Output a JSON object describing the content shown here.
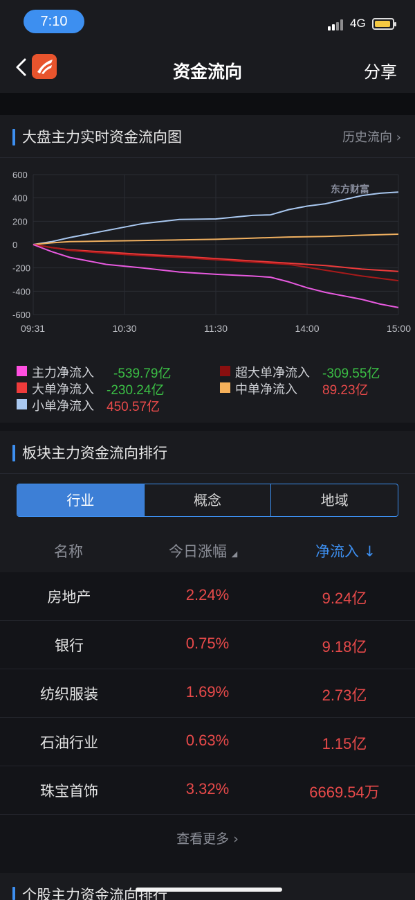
{
  "status": {
    "time": "7:10",
    "network": "4G"
  },
  "nav": {
    "title": "资金流向",
    "share": "分享"
  },
  "chart_section": {
    "title": "大盘主力实时资金流向图",
    "history_link": "历史流向",
    "watermark": "东方财富"
  },
  "chart_data": {
    "type": "line",
    "x_ticks": [
      "09:31",
      "10:30",
      "11:30",
      "14:00",
      "15:00"
    ],
    "y_ticks": [
      "600",
      "400",
      "200",
      "0",
      "-200",
      "-400",
      "-600"
    ],
    "ylim": [
      -600,
      600
    ],
    "grid": true,
    "series": [
      {
        "name": "小单净流入",
        "color": "#a9c8f0",
        "points": [
          [
            0,
            0
          ],
          [
            0.05,
            25
          ],
          [
            0.1,
            60
          ],
          [
            0.2,
            120
          ],
          [
            0.3,
            180
          ],
          [
            0.4,
            215
          ],
          [
            0.5,
            220
          ],
          [
            0.6,
            250
          ],
          [
            0.65,
            255
          ],
          [
            0.7,
            300
          ],
          [
            0.75,
            330
          ],
          [
            0.8,
            350
          ],
          [
            0.85,
            385
          ],
          [
            0.9,
            420
          ],
          [
            0.95,
            440
          ],
          [
            1,
            450.57
          ]
        ]
      },
      {
        "name": "中单净流入",
        "color": "#f0b060",
        "points": [
          [
            0,
            0
          ],
          [
            0.05,
            15
          ],
          [
            0.1,
            25
          ],
          [
            0.2,
            30
          ],
          [
            0.3,
            35
          ],
          [
            0.4,
            40
          ],
          [
            0.5,
            45
          ],
          [
            0.6,
            55
          ],
          [
            0.7,
            65
          ],
          [
            0.8,
            70
          ],
          [
            0.9,
            80
          ],
          [
            1,
            89.23
          ]
        ]
      },
      {
        "name": "大单净流入",
        "color": "#ee3b3b",
        "points": [
          [
            0,
            0
          ],
          [
            0.05,
            -25
          ],
          [
            0.1,
            -45
          ],
          [
            0.2,
            -65
          ],
          [
            0.3,
            -85
          ],
          [
            0.4,
            -100
          ],
          [
            0.5,
            -120
          ],
          [
            0.6,
            -140
          ],
          [
            0.7,
            -160
          ],
          [
            0.8,
            -180
          ],
          [
            0.9,
            -210
          ],
          [
            1,
            -230.24
          ]
        ]
      },
      {
        "name": "超大单净流入",
        "color": "#a81a1a",
        "points": [
          [
            0,
            0
          ],
          [
            0.1,
            -50
          ],
          [
            0.2,
            -75
          ],
          [
            0.3,
            -95
          ],
          [
            0.4,
            -110
          ],
          [
            0.5,
            -130
          ],
          [
            0.6,
            -150
          ],
          [
            0.7,
            -170
          ],
          [
            0.75,
            -195
          ],
          [
            0.8,
            -220
          ],
          [
            0.9,
            -270
          ],
          [
            1,
            -309.55
          ]
        ]
      },
      {
        "name": "主力净流入",
        "color": "#e85ae0",
        "points": [
          [
            0,
            0
          ],
          [
            0.05,
            -60
          ],
          [
            0.1,
            -110
          ],
          [
            0.2,
            -170
          ],
          [
            0.3,
            -200
          ],
          [
            0.4,
            -235
          ],
          [
            0.5,
            -255
          ],
          [
            0.6,
            -270
          ],
          [
            0.65,
            -280
          ],
          [
            0.7,
            -320
          ],
          [
            0.75,
            -370
          ],
          [
            0.8,
            -410
          ],
          [
            0.9,
            -470
          ],
          [
            0.95,
            -510
          ],
          [
            1,
            -539.79
          ]
        ]
      }
    ]
  },
  "legend": [
    {
      "label": "主力净流入",
      "value": "-539.79亿",
      "swatch": "#ff4fe0",
      "value_color": "#3bbf45"
    },
    {
      "label": "超大单净流入",
      "value": "-309.55亿",
      "swatch": "#8a0f0f",
      "value_color": "#3bbf45"
    },
    {
      "label": "大单净流入",
      "value": "-230.24亿",
      "swatch": "#ee3b3b",
      "value_color": "#3bbf45"
    },
    {
      "label": "中单净流入",
      "value": "89.23亿",
      "swatch": "#f5b05a",
      "value_color": "#e84a4a"
    },
    {
      "label": "小单净流入",
      "value": "450.57亿",
      "swatch": "#a9c8f0",
      "value_color": "#e84a4a"
    }
  ],
  "ranking_section": {
    "title": "板块主力资金流向排行",
    "tabs": [
      "行业",
      "概念",
      "地域"
    ],
    "columns": {
      "name": "名称",
      "change": "今日涨幅",
      "flow": "净流入 ↓"
    },
    "rows": [
      {
        "name": "房地产",
        "change": "2.24%",
        "flow": "9.24亿"
      },
      {
        "name": "银行",
        "change": "0.75%",
        "flow": "9.18亿"
      },
      {
        "name": "纺织服装",
        "change": "1.69%",
        "flow": "2.73亿"
      },
      {
        "name": "石油行业",
        "change": "0.63%",
        "flow": "1.15亿"
      },
      {
        "name": "珠宝首饰",
        "change": "3.32%",
        "flow": "6669.54万"
      }
    ],
    "more": "查看更多"
  },
  "stock_section": {
    "title": "个股主力资金流向排行"
  }
}
